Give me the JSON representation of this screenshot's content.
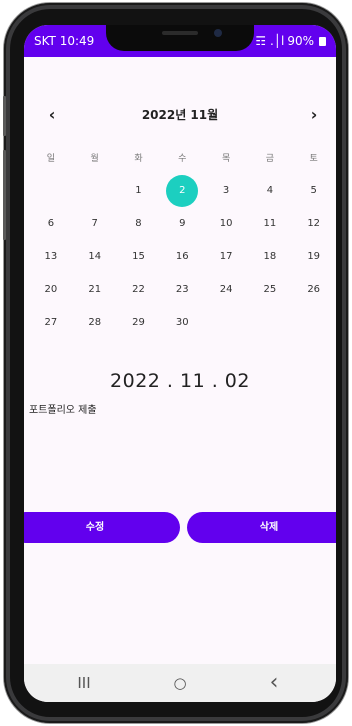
{
  "status": {
    "left_text": "SKT 10:49 ",
    "battery": "90%",
    "signal_text": "❉ ☶ .│l"
  },
  "calendar": {
    "title": "2022년 11월",
    "prev": "‹",
    "next": "›",
    "weekdays": [
      "일",
      "월",
      "화",
      "수",
      "목",
      "금",
      "토"
    ],
    "weeks": [
      [
        "",
        "",
        "1",
        "2",
        "3",
        "4",
        "5"
      ],
      [
        "6",
        "7",
        "8",
        "9",
        "10",
        "11",
        "12"
      ],
      [
        "13",
        "14",
        "15",
        "16",
        "17",
        "18",
        "19"
      ],
      [
        "20",
        "21",
        "22",
        "23",
        "24",
        "25",
        "26"
      ],
      [
        "27",
        "28",
        "29",
        "30",
        "",
        "",
        ""
      ]
    ],
    "selected": "2"
  },
  "detail": {
    "date": "2022 . 11 . 02",
    "memo": "포트폴리오 제출"
  },
  "buttons": {
    "edit": "수정",
    "delete": "삭제"
  },
  "navbar": {
    "recents": "III",
    "home": "○",
    "back": "‹"
  },
  "colors": {
    "primary": "#6200ee",
    "selected": "#1ccfc0",
    "background": "#fdf8fd"
  }
}
